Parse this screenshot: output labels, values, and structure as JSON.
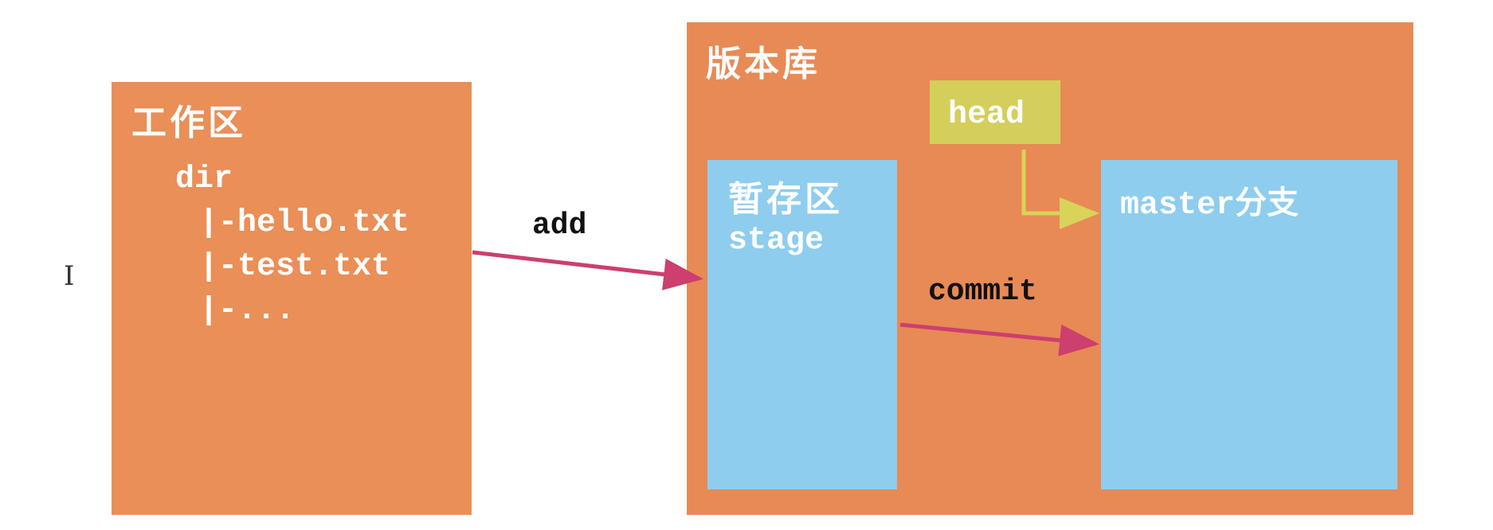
{
  "workspace": {
    "title": "工作区",
    "tree": {
      "root": "dir",
      "items": [
        "|-hello.txt",
        "|-test.txt",
        "|-..."
      ]
    }
  },
  "repository": {
    "title": "版本库",
    "head": "head",
    "stage": {
      "title": "暂存区",
      "subtitle": "stage"
    },
    "master": {
      "title": "master分支"
    }
  },
  "arrows": {
    "add": "add",
    "commit": "commit"
  },
  "colors": {
    "box_orange": "#e98f57",
    "repo_orange": "#e88a55",
    "stage_blue": "#8ecdee",
    "head_yellow": "#d4cf5a",
    "arrow_pink": "#cc3f6e",
    "head_arrow": "#d9d35a"
  },
  "icons": {
    "cursor": "text-cursor-icon"
  }
}
